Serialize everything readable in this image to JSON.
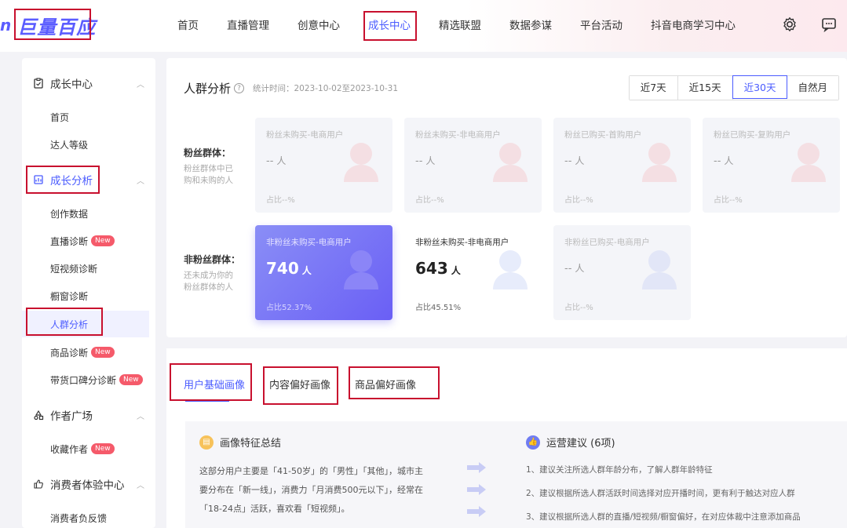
{
  "brand": {
    "prefix": "n",
    "name": "巨量百应"
  },
  "nav": [
    "首页",
    "直播管理",
    "创意中心",
    "成长中心",
    "精选联盟",
    "数据参谋",
    "平台活动",
    "抖音电商学习中心"
  ],
  "nav_active_index": 3,
  "top_icons": [
    "settings-icon",
    "message-icon"
  ],
  "sidebar": {
    "group1": {
      "label": "成长中心",
      "items": [
        "首页",
        "达人等级"
      ]
    },
    "group2": {
      "label": "成长分析",
      "items": [
        "创作数据",
        "直播诊断",
        "短视频诊断",
        "橱窗诊断",
        "人群分析",
        "商品诊断",
        "带货口碑分诊断"
      ]
    },
    "group3": {
      "label": "作者广场",
      "items": [
        "收藏作者"
      ]
    },
    "group4": {
      "label": "消费者体验中心",
      "items": [
        "消费者负反馈"
      ]
    },
    "new_badge": "New"
  },
  "panel": {
    "title": "人群分析",
    "stat_time": "统计时间：2023-10-02至2023-10-31",
    "ranges": [
      "近7天",
      "近15天",
      "近30天",
      "自然月"
    ],
    "active_range": "近30天"
  },
  "fan_group": {
    "label": "粉丝群体：",
    "desc": "粉丝群体中已购和未购的人",
    "cards": [
      {
        "title": "粉丝未购买-电商用户",
        "value": "--",
        "unit": "人",
        "pct": "占比--%"
      },
      {
        "title": "粉丝未购买-非电商用户",
        "value": "--",
        "unit": "人",
        "pct": "占比--%"
      },
      {
        "title": "粉丝已购买-首购用户",
        "value": "--",
        "unit": "人",
        "pct": "占比--%"
      },
      {
        "title": "粉丝已购买-复购用户",
        "value": "--",
        "unit": "人",
        "pct": "占比--%"
      }
    ]
  },
  "nonfan_group": {
    "label": "非粉丝群体：",
    "desc": "还未成为你的粉丝群体的人",
    "cards": [
      {
        "title": "非粉丝未购买-电商用户",
        "value": "740",
        "unit": "人",
        "pct": "占比52.37%"
      },
      {
        "title": "非粉丝未购买-非电商用户",
        "value": "643",
        "unit": "人",
        "pct": "占比45.51%"
      },
      {
        "title": "非粉丝已购买-电商用户",
        "value": "--",
        "unit": "人",
        "pct": "占比--%"
      }
    ]
  },
  "tabs": [
    "用户基础画像",
    "内容偏好画像",
    "商品偏好画像"
  ],
  "summary": {
    "title": "画像特征总结",
    "text": "这部分用户主要是「41-50岁」的「男性」「其他」，城市主要分布在「新一线」，消费力「月消费500元以下」，经常在「18-24点」活跃，喜欢看「短视频」。"
  },
  "advice": {
    "title": "运营建议 (6项)",
    "items": [
      "1、建议关注所选人群年龄分布，了解人群年龄特征",
      "2、建议根据所选人群活跃时间选择对应开播时间，更有利于触达对应人群",
      "3、建议根据所选人群的直播/短视频/橱窗偏好，在对应体裁中注意添加商品"
    ]
  },
  "colors": {
    "accent": "#4b5cff",
    "highlight": "#c8102e",
    "card_purple": "#7a74f5",
    "badge": "#f55a6a"
  }
}
